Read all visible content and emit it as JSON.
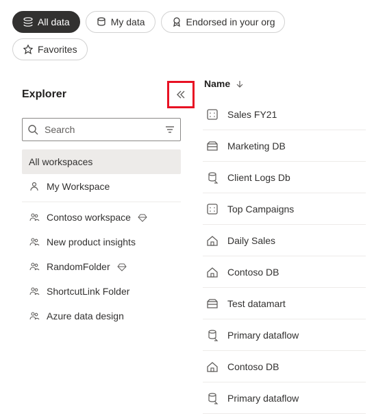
{
  "filters": {
    "all_data": "All data",
    "my_data": "My data",
    "endorsed": "Endorsed in your org",
    "favorites": "Favorites"
  },
  "explorer": {
    "title": "Explorer",
    "search_placeholder": "Search",
    "workspaces": {
      "all": "All workspaces",
      "items": [
        {
          "label": "My Workspace",
          "icon": "person",
          "trailing": null
        },
        {
          "label": "Contoso workspace",
          "icon": "group",
          "trailing": "gem"
        },
        {
          "label": "New product insights",
          "icon": "group",
          "trailing": null
        },
        {
          "label": "RandomFolder",
          "icon": "group",
          "trailing": "gem"
        },
        {
          "label": "ShortcutLink Folder",
          "icon": "group",
          "trailing": null
        },
        {
          "label": "Azure data design",
          "icon": "group",
          "trailing": null
        }
      ]
    }
  },
  "datalist": {
    "column": "Name",
    "rows": [
      {
        "label": "Sales FY21",
        "icon": "dataset"
      },
      {
        "label": "Marketing DB",
        "icon": "datamart"
      },
      {
        "label": "Client Logs Db",
        "icon": "dataflow"
      },
      {
        "label": "Top Campaigns",
        "icon": "dataset"
      },
      {
        "label": "Daily Sales",
        "icon": "house"
      },
      {
        "label": "Contoso DB",
        "icon": "house"
      },
      {
        "label": "Test datamart",
        "icon": "datamart"
      },
      {
        "label": "Primary dataflow",
        "icon": "dataflow"
      },
      {
        "label": "Contoso DB",
        "icon": "house"
      },
      {
        "label": "Primary dataflow",
        "icon": "dataflow"
      }
    ]
  }
}
